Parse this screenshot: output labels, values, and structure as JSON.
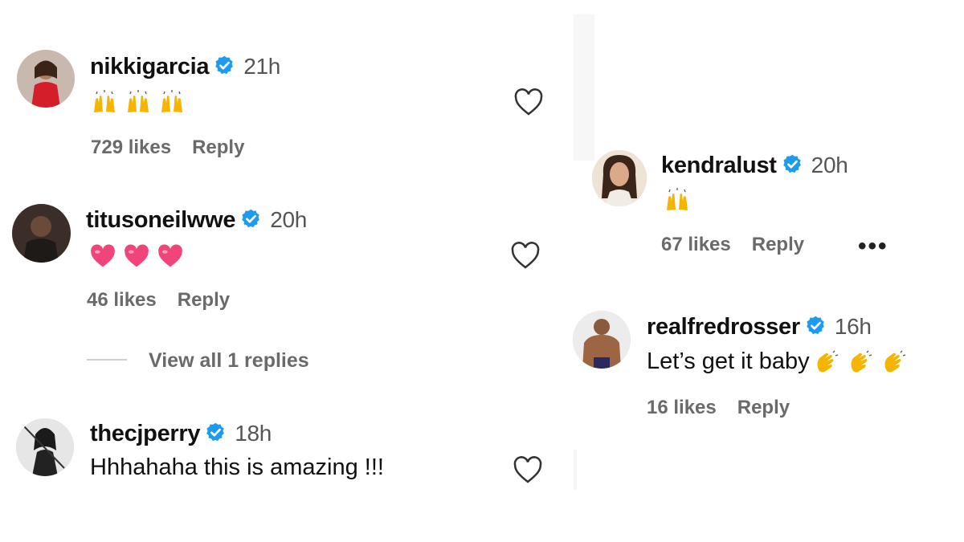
{
  "comments": [
    {
      "username": "nikkigarcia",
      "time": "21h",
      "text": "",
      "emoji": [
        "raising-hands",
        "raising-hands",
        "raising-hands"
      ],
      "likes": "729 likes",
      "reply": "Reply"
    },
    {
      "username": "titusoneilwwe",
      "time": "20h",
      "text": "",
      "emoji": [
        "pink-heart",
        "pink-heart",
        "pink-heart"
      ],
      "likes": "46 likes",
      "reply": "Reply",
      "view_replies": "View all 1 replies"
    },
    {
      "username": "thecjperry",
      "time": "18h",
      "text": "Hhhahaha this is amazing !!!",
      "likes": "",
      "reply": ""
    },
    {
      "username": "kendralust",
      "time": "20h",
      "text": "",
      "emoji": [
        "raising-hands"
      ],
      "likes": "67 likes",
      "reply": "Reply",
      "more": "•••"
    },
    {
      "username": "realfredrosser",
      "time": "16h",
      "text": "Let’s get it baby",
      "emoji": [
        "clapping-hands",
        "clapping-hands",
        "clapping-hands"
      ],
      "likes": "16 likes",
      "reply": "Reply"
    }
  ],
  "colors": {
    "verified_badge": "#1d9bf0",
    "meta_text": "#6a6a6a",
    "raising_hands": "#f4b400",
    "pink_heart": "#f0457a"
  }
}
